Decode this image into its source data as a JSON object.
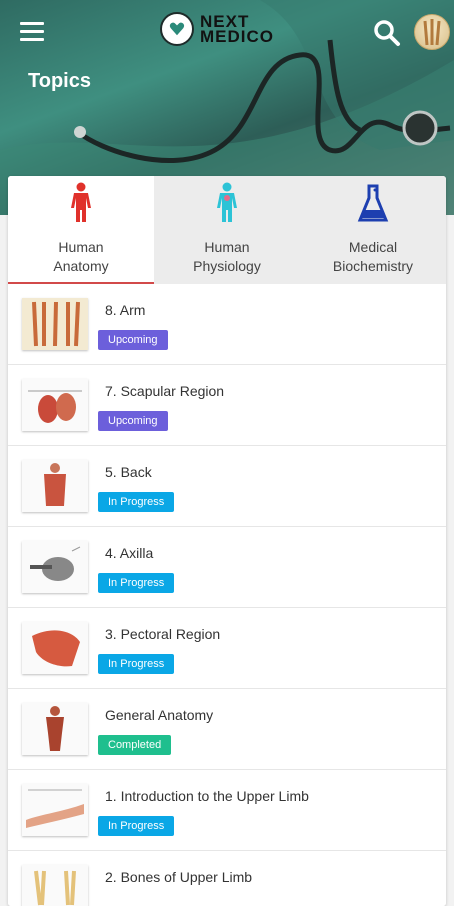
{
  "header": {
    "logo_line1": "NEXT",
    "logo_line2": "MEDICO",
    "page_title": "Topics"
  },
  "tabs": [
    {
      "line1": "Human",
      "line2": "Anatomy",
      "icon": "anatomy-body-icon",
      "color": "#e0312b",
      "active": true
    },
    {
      "line1": "Human",
      "line2": "Physiology",
      "icon": "physiology-body-icon",
      "color": "#2cc3d6",
      "active": false
    },
    {
      "line1": "Medical",
      "line2": "Biochemistry",
      "icon": "flask-icon",
      "color": "#1d3fb0",
      "active": false
    }
  ],
  "status_colors": {
    "Upcoming": "#6c5fdb",
    "In Progress": "#0aa7e6",
    "Completed": "#1fbf8e"
  },
  "topics": [
    {
      "name": "8. Arm",
      "status": "Upcoming",
      "thumb": "arm-muscles-image"
    },
    {
      "name": "7. Scapular Region",
      "status": "Upcoming",
      "thumb": "scapular-region-image"
    },
    {
      "name": "5. Back",
      "status": "In Progress",
      "thumb": "back-muscles-image"
    },
    {
      "name": "4. Axilla",
      "status": "In Progress",
      "thumb": "axilla-image"
    },
    {
      "name": "3. Pectoral Region",
      "status": "In Progress",
      "thumb": "pectoral-region-image"
    },
    {
      "name": "General Anatomy",
      "status": "Completed",
      "thumb": "torso-anatomy-image"
    },
    {
      "name": "1. Introduction to the Upper Limb",
      "status": "In Progress",
      "thumb": "upper-limb-image"
    },
    {
      "name": "2. Bones of Upper Limb",
      "status": "",
      "thumb": "upper-limb-bones-image"
    }
  ]
}
